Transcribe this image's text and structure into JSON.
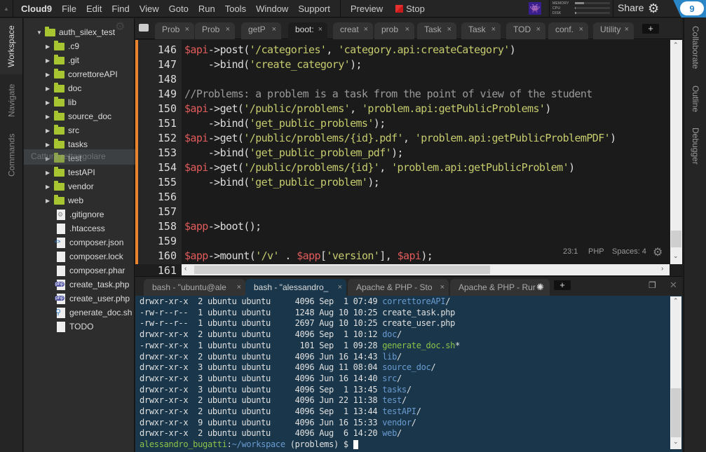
{
  "menubar": {
    "brand": "Cloud9",
    "items": [
      "File",
      "Edit",
      "Find",
      "View",
      "Goto",
      "Run",
      "Tools",
      "Window",
      "Support"
    ],
    "preview": "Preview",
    "stop": "Stop",
    "stats": [
      {
        "label": "MEMORY",
        "fraction": 0.25
      },
      {
        "label": "CPU",
        "fraction": 0.02
      },
      {
        "label": "DISK",
        "fraction": 0.03
      }
    ],
    "share": "Share"
  },
  "left_panel": {
    "tabs": [
      "Workspace",
      "Navigate",
      "Commands"
    ]
  },
  "right_panel": {
    "tabs": [
      "Collaborate",
      "Outline",
      "Debugger"
    ]
  },
  "tree": {
    "root": "auth_silex_test",
    "folders": [
      ".c9",
      ".git",
      "correttoreAPI",
      "doc",
      "lib",
      "source_doc",
      "src",
      "tasks",
      "test",
      "testAPI",
      "vendor",
      "web"
    ],
    "files": [
      {
        "name": ".gitignore",
        "icon": "gitignore-file-icon"
      },
      {
        "name": ".htaccess",
        "icon": "text-file-icon"
      },
      {
        "name": "composer.json",
        "icon": "json-file-icon"
      },
      {
        "name": "composer.lock",
        "icon": "text-file-icon"
      },
      {
        "name": "composer.phar",
        "icon": "text-file-icon"
      },
      {
        "name": "create_task.php",
        "icon": "php-file-icon"
      },
      {
        "name": "create_user.php",
        "icon": "php-file-icon"
      },
      {
        "name": "generate_doc.sh",
        "icon": "shell-file-icon"
      },
      {
        "name": "TODO",
        "icon": "text-file-icon"
      }
    ],
    "ghost_tooltip": "Cattura rettangolare"
  },
  "editor_tabs": [
    {
      "label": "Prob",
      "active": false
    },
    {
      "label": "Prob",
      "active": false
    },
    {
      "label": "getP",
      "active": false
    },
    {
      "label": "boot:",
      "active": true
    },
    {
      "label": "creat",
      "active": false
    },
    {
      "label": "prob",
      "active": false
    },
    {
      "label": "Task",
      "active": false
    },
    {
      "label": "Task",
      "active": false
    },
    {
      "label": "TOD",
      "active": false
    },
    {
      "label": "conf.",
      "active": false
    },
    {
      "label": "Utility",
      "active": false
    }
  ],
  "editor": {
    "line_numbers": [
      "146",
      "147",
      "148",
      "149",
      "150",
      "151",
      "152",
      "153",
      "154",
      "155",
      "156",
      "157",
      "158",
      "159",
      "160",
      "161"
    ],
    "lines": [
      [
        [
          "var",
          "$api"
        ],
        [
          "op",
          "->post("
        ],
        [
          "str",
          "'/categories'"
        ],
        [
          "op",
          ", "
        ],
        [
          "str",
          "'category.api:createCategory'"
        ],
        [
          "op",
          ")"
        ]
      ],
      [
        [
          "op",
          "    ->bind("
        ],
        [
          "str",
          "'create_category'"
        ],
        [
          "op",
          ");"
        ]
      ],
      [],
      [
        [
          "cmt",
          "//Problems: a problem is a task from the point of view of the student"
        ]
      ],
      [
        [
          "var",
          "$api"
        ],
        [
          "op",
          "->get("
        ],
        [
          "str",
          "'/public/problems'"
        ],
        [
          "op",
          ", "
        ],
        [
          "str",
          "'problem.api:getPublicProblems'"
        ],
        [
          "op",
          ")"
        ]
      ],
      [
        [
          "op",
          "    ->bind("
        ],
        [
          "str",
          "'get_public_problems'"
        ],
        [
          "op",
          ");"
        ]
      ],
      [
        [
          "var",
          "$api"
        ],
        [
          "op",
          "->get("
        ],
        [
          "str",
          "'/public/problems/{id}.pdf'"
        ],
        [
          "op",
          ", "
        ],
        [
          "str",
          "'problem.api:getPublicProblemPDF'"
        ],
        [
          "op",
          ")"
        ]
      ],
      [
        [
          "op",
          "    ->bind("
        ],
        [
          "str",
          "'get_public_problem_pdf'"
        ],
        [
          "op",
          ");"
        ]
      ],
      [
        [
          "var",
          "$api"
        ],
        [
          "op",
          "->get("
        ],
        [
          "str",
          "'/public/problems/{id}'"
        ],
        [
          "op",
          ", "
        ],
        [
          "str",
          "'problem.api:getPublicProblem'"
        ],
        [
          "op",
          ")"
        ]
      ],
      [
        [
          "op",
          "    ->bind("
        ],
        [
          "str",
          "'get_public_problem'"
        ],
        [
          "op",
          ");"
        ]
      ],
      [],
      [],
      [
        [
          "var",
          "$app"
        ],
        [
          "op",
          "->boot();"
        ]
      ],
      [],
      [
        [
          "var",
          "$app"
        ],
        [
          "op",
          "->mount("
        ],
        [
          "str",
          "'/v'"
        ],
        [
          "op",
          " . "
        ],
        [
          "var",
          "$app"
        ],
        [
          "op",
          "["
        ],
        [
          "str",
          "'version'"
        ],
        [
          "op",
          "], "
        ],
        [
          "var",
          "$api"
        ],
        [
          "op",
          ");"
        ]
      ],
      []
    ],
    "status": {
      "position": "23:1",
      "language": "PHP",
      "indent": "Spaces: 4"
    }
  },
  "terminal_tabs": [
    {
      "label": "bash - \"ubuntu@ale",
      "active": false
    },
    {
      "label": "bash - \"alessandro_",
      "active": true
    },
    {
      "label": "Apache & PHP - Sto",
      "active": false
    },
    {
      "label": "Apache & PHP - Rur",
      "active": false,
      "loading": true
    }
  ],
  "terminal": {
    "rows": [
      {
        "perm": "drwxr-xr-x",
        "links": "2",
        "user": "ubuntu",
        "group": "ubuntu",
        "size": "4096",
        "date": "Sep  1 07:49",
        "name": "correttoreAPI",
        "suffix": "/",
        "kind": "dir"
      },
      {
        "perm": "-rw-r--r--",
        "links": "1",
        "user": "ubuntu",
        "group": "ubuntu",
        "size": "1248",
        "date": "Aug 10 10:25",
        "name": "create_task.php",
        "suffix": "",
        "kind": "file"
      },
      {
        "perm": "-rw-r--r--",
        "links": "1",
        "user": "ubuntu",
        "group": "ubuntu",
        "size": "2697",
        "date": "Aug 10 10:25",
        "name": "create_user.php",
        "suffix": "",
        "kind": "file"
      },
      {
        "perm": "drwxr-xr-x",
        "links": "2",
        "user": "ubuntu",
        "group": "ubuntu",
        "size": "4096",
        "date": "Sep  1 10:12",
        "name": "doc",
        "suffix": "/",
        "kind": "dir"
      },
      {
        "perm": "-rwxr-xr-x",
        "links": "1",
        "user": "ubuntu",
        "group": "ubuntu",
        "size": " 101",
        "date": "Sep  1 09:28",
        "name": "generate_doc.sh",
        "suffix": "*",
        "kind": "exe"
      },
      {
        "perm": "drwxr-xr-x",
        "links": "2",
        "user": "ubuntu",
        "group": "ubuntu",
        "size": "4096",
        "date": "Jun 16 14:43",
        "name": "lib",
        "suffix": "/",
        "kind": "dir"
      },
      {
        "perm": "drwxr-xr-x",
        "links": "3",
        "user": "ubuntu",
        "group": "ubuntu",
        "size": "4096",
        "date": "Aug 11 08:04",
        "name": "source_doc",
        "suffix": "/",
        "kind": "dir"
      },
      {
        "perm": "drwxr-xr-x",
        "links": "3",
        "user": "ubuntu",
        "group": "ubuntu",
        "size": "4096",
        "date": "Jun 16 14:40",
        "name": "src",
        "suffix": "/",
        "kind": "dir"
      },
      {
        "perm": "drwxr-xr-x",
        "links": "3",
        "user": "ubuntu",
        "group": "ubuntu",
        "size": "4096",
        "date": "Sep  1 13:45",
        "name": "tasks",
        "suffix": "/",
        "kind": "dir"
      },
      {
        "perm": "drwxr-xr-x",
        "links": "2",
        "user": "ubuntu",
        "group": "ubuntu",
        "size": "4096",
        "date": "Jun 22 11:38",
        "name": "test",
        "suffix": "/",
        "kind": "dir"
      },
      {
        "perm": "drwxr-xr-x",
        "links": "2",
        "user": "ubuntu",
        "group": "ubuntu",
        "size": "4096",
        "date": "Sep  1 13:44",
        "name": "testAPI",
        "suffix": "/",
        "kind": "dir"
      },
      {
        "perm": "drwxr-xr-x",
        "links": "9",
        "user": "ubuntu",
        "group": "ubuntu",
        "size": "4096",
        "date": "Jun 16 15:33",
        "name": "vendor",
        "suffix": "/",
        "kind": "dir"
      },
      {
        "perm": "drwxr-xr-x",
        "links": "2",
        "user": "ubuntu",
        "group": "ubuntu",
        "size": "4096",
        "date": "Aug  6 14:20",
        "name": "web",
        "suffix": "/",
        "kind": "dir"
      }
    ],
    "prompt": {
      "user": "alessandro_bugatti",
      "path": "~/workspace",
      "branch": "(problems)",
      "symbol": "$"
    }
  },
  "colors": {
    "accent_orange": "#e8832e",
    "folder_green": "#a6c530",
    "terminal_bg": "#19364a",
    "cloud9_blue": "#2b86c7"
  }
}
